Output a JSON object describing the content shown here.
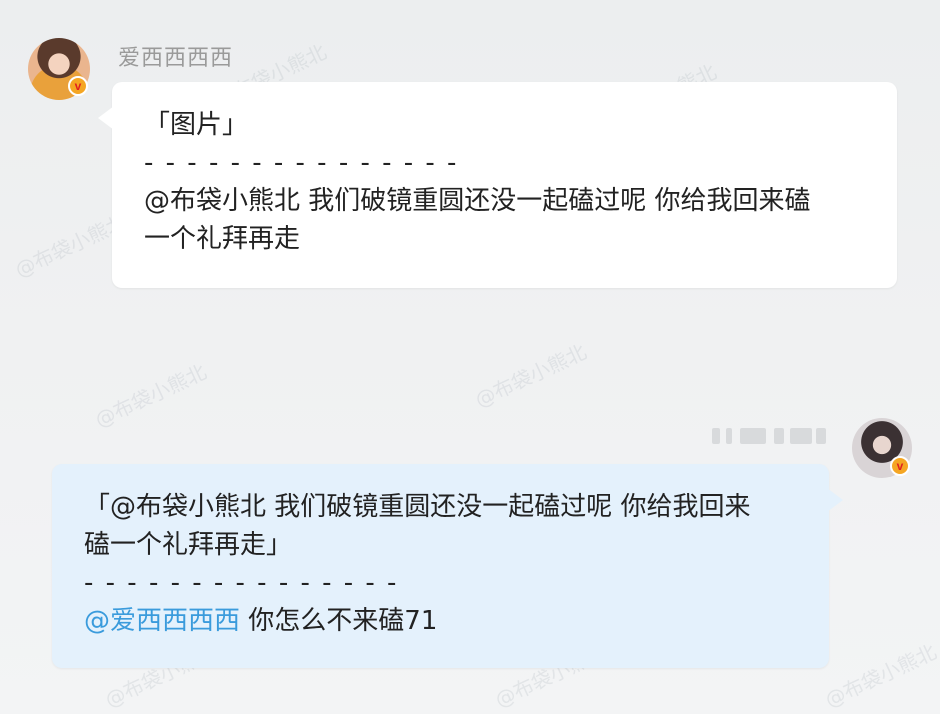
{
  "thread": {
    "received": {
      "username": "爱西西西西",
      "verified_badge": "v",
      "lines": {
        "quote": "「图片」",
        "separator": "- - - - - - - - - - - - - - -",
        "body_line1": "@布袋小熊北 我们破镜重圆还没一起磕过呢 你给我回来磕",
        "body_line2": "一个礼拜再走"
      }
    },
    "sent": {
      "verified_badge": "v",
      "lines": {
        "quote_line1": "「@布袋小熊北 我们破镜重圆还没一起磕过呢 你给我回来",
        "quote_line2": "磕一个礼拜再走」",
        "separator": "- - - - - - - - - - - - - - -",
        "mention": "@爱西西西西",
        "reply": " 你怎么不来磕71"
      }
    }
  },
  "watermark": "@布袋小熊北",
  "colors": {
    "mention": "#3a9bdc",
    "sent_bubble": "#e4f1fc",
    "received_bubble": "#ffffff",
    "badge": "#f5a623"
  },
  "icons": [
    "verified-badge-icon"
  ]
}
